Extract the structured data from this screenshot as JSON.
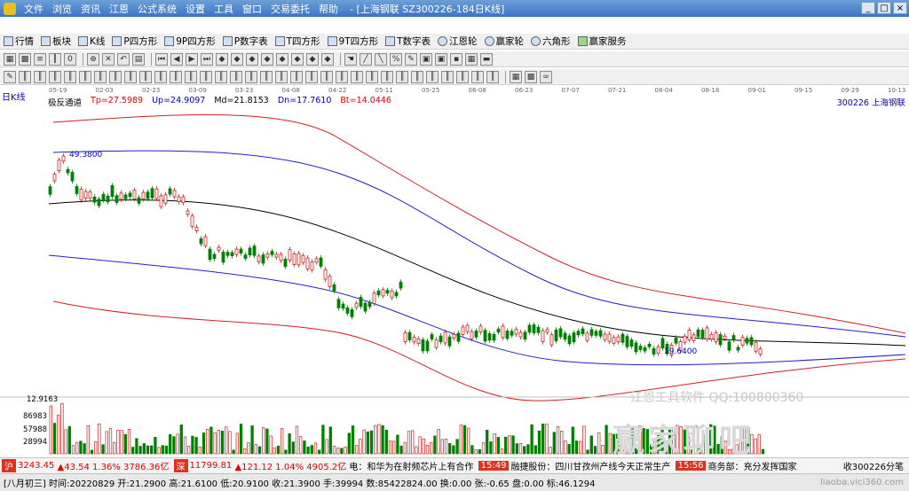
{
  "window": {
    "menu": [
      "文件",
      "浏览",
      "资讯",
      "江恩",
      "公式系统",
      "设置",
      "工具",
      "窗口",
      "交易委托",
      "帮助"
    ],
    "title": "- [上海钢联  SZ300226-184日K线]",
    "controls": [
      "_",
      "□",
      "×"
    ]
  },
  "toolbar1": [
    "行情",
    "板块",
    "K线",
    "P四方形",
    "9P四方形",
    "P数字表",
    "T四方形",
    "9T四方形",
    "T数字表",
    "江恩轮",
    "赢家轮",
    "六角形",
    "赢家服务"
  ],
  "chart": {
    "period_label": "日K线",
    "indicator": {
      "name": "极反通道",
      "tp": "Tp=27.5989",
      "up": "Up=24.9097",
      "md": "Md=21.8153",
      "dn": "Dn=17.7610",
      "bt": "Bt=14.0446"
    },
    "stock": "300226  上海钢联",
    "date_ticks": [
      "05-19",
      "02-03",
      "02-23",
      "03-09",
      "03-23",
      "04-08",
      "04-22",
      "05-11",
      "05-25",
      "06-08",
      "06-23",
      "07-07",
      "07-21",
      "08-04",
      "08-18",
      "09-01",
      "09-15",
      "09-29",
      "10-13"
    ],
    "high_label": "49.3800",
    "low_label": "19.6400",
    "vol_ticks": [
      "12.9163",
      "86983",
      "57988",
      "28994"
    ],
    "watermark": "江恩工具软件  QQ:100800360",
    "watermark_big": "赢家聊吧"
  },
  "chart_data": {
    "type": "line",
    "series": [
      {
        "name": "Tp",
        "values": [
          27.5989
        ]
      },
      {
        "name": "Up",
        "values": [
          24.9097
        ]
      },
      {
        "name": "Md",
        "values": [
          21.8153
        ]
      },
      {
        "name": "Dn",
        "values": [
          17.761
        ]
      },
      {
        "name": "Bt",
        "values": [
          14.0446
        ]
      }
    ],
    "high": 49.38,
    "low": 19.64
  },
  "status1": {
    "sh": "3243.45",
    "sh_chg": "▲43.54 1.36% 3786.36亿",
    "sz": "11799.81",
    "sz_chg": "▲121.12 1.04% 4905.2亿",
    "news1": "电：和华为在射频芯片上有合作",
    "time1": "15:49",
    "news2": "融捷股份：四川甘孜州产线今天正常生产",
    "time2": "15:56",
    "news3": "商务部：充分发挥国家",
    "right": "收300226分笔"
  },
  "status2": {
    "text": "[八月初三] 时间:20220829 开:21.2900 高:21.6100 低:20.9100 收:21.3900 手:39994 数:85422824.00 换:0.00 张:-0.65 盘:0.00 标:46.1294",
    "site": "liaoba.vici360.com"
  }
}
